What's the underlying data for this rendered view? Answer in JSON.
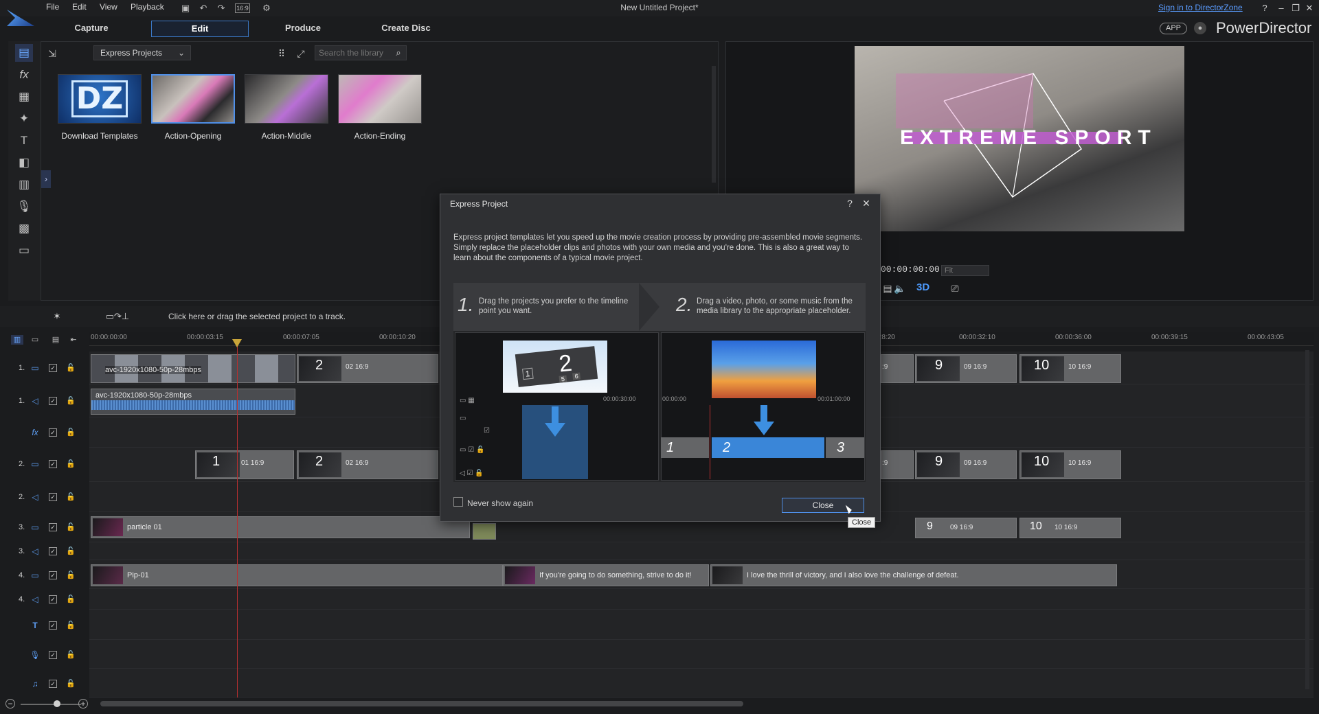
{
  "window": {
    "title": "New Untitled Project*",
    "signin": "Sign in to DirectorZone",
    "menu": [
      "File",
      "Edit",
      "View",
      "Playback"
    ],
    "aspect": "16:9"
  },
  "tabs": [
    {
      "label": "Capture"
    },
    {
      "label": "Edit"
    },
    {
      "label": "Produce"
    },
    {
      "label": "Create Disc"
    }
  ],
  "brand": {
    "app_badge": "APP",
    "name": "PowerDirector"
  },
  "library": {
    "dropdown_value": "Express Projects",
    "search_placeholder": "Search the library",
    "items": [
      {
        "label": "Download Templates",
        "logo": "DZ"
      },
      {
        "label": "Action-Opening"
      },
      {
        "label": "Action-Middle"
      },
      {
        "label": "Action-Ending"
      }
    ]
  },
  "preview": {
    "overlay_title": "EXTREME SPORT",
    "timecode": "00:00:00:00",
    "fit": "Fit",
    "mode_3d": "3D"
  },
  "timeline": {
    "hint": "Click here or drag the selected project to a track.",
    "ruler": [
      "00:00:00:00",
      "00:00:03:15",
      "00:00:07:05",
      "00:00:10:20",
      "00:00:28:20",
      "00:00:32:10",
      "00:00:36:00",
      "00:00:39:15",
      "00:00:43:05"
    ],
    "tracks": [
      {
        "num": "1."
      },
      {
        "num": "1."
      },
      {
        "num": ""
      },
      {
        "num": "2."
      },
      {
        "num": "2."
      },
      {
        "num": "3."
      },
      {
        "num": "3."
      },
      {
        "num": "4."
      },
      {
        "num": "4."
      },
      {
        "num": ""
      },
      {
        "num": ""
      },
      {
        "num": ""
      }
    ],
    "clips": {
      "video1": "avc-1920x1080-50p-28mbps",
      "audio1": "avc-1920x1080-50p-28mbps",
      "particle": "particle 01",
      "pip": "Pip-01",
      "title1": "If you're going to do something, strive to do it!",
      "title2": "I love the thrill of victory, and I also love the challenge of defeat.",
      "n1": "1",
      "n2": "2",
      "n9": "9",
      "n10": "10",
      "r_1": "01 16:9",
      "r_2": "02 16:9",
      "r_9": "09 16:9",
      "r_10": "10 16:9"
    }
  },
  "dialog": {
    "title": "Express Project",
    "description": "Express project templates let you speed up the movie creation process by providing pre-assembled movie segments. Simply replace the placeholder clips and photos with your own media and you're done. This is also a great way to learn about the components of a typical movie project.",
    "step1_num": "1.",
    "step1_text": "Drag the projects you prefer to the timeline point you want.",
    "step2_num": "2.",
    "step2_text": "Drag a video, photo, or some music from the media library to the appropriate placeholder.",
    "panel1_time_a": "00:00:30:00",
    "panel2_time_a": "00:00:00",
    "panel2_time_b": "00:01:00:00",
    "panel1_big": "2",
    "panel1_small": "1",
    "panel1_cells": [
      "5",
      "6"
    ],
    "slots": [
      "1",
      "2",
      "3"
    ],
    "never_show": "Never show again",
    "close_label": "Close",
    "tooltip": "Close"
  }
}
